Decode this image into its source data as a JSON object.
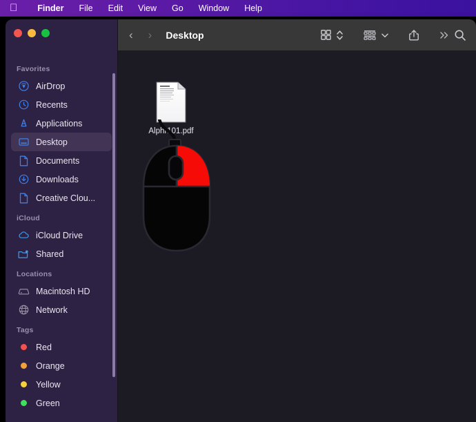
{
  "menubar": {
    "apple_icon": "apple-logo",
    "items": [
      {
        "label": "Finder",
        "bold": true
      },
      {
        "label": "File",
        "bold": false
      },
      {
        "label": "Edit",
        "bold": false
      },
      {
        "label": "View",
        "bold": false
      },
      {
        "label": "Go",
        "bold": false
      },
      {
        "label": "Window",
        "bold": false
      },
      {
        "label": "Help",
        "bold": false
      }
    ]
  },
  "window": {
    "traffic_lights": {
      "close_color": "#f2564f",
      "minimize_color": "#fcbb40",
      "maximize_color": "#17c341"
    },
    "toolbar": {
      "back_icon": "chevron-left-icon",
      "forward_icon": "chevron-right-icon",
      "title": "Desktop",
      "view_icon": "icon-view-grid-icon",
      "view_stepper_icon": "chevron-up-down-icon",
      "group_icon": "group-by-icon",
      "group_chevron_icon": "chevron-down-icon",
      "share_icon": "share-icon",
      "more_icon": "double-chevron-right-icon",
      "search_icon": "search-icon"
    }
  },
  "sidebar": {
    "sections": [
      {
        "title": "Favorites",
        "items": [
          {
            "label": "AirDrop",
            "icon": "airdrop-icon",
            "selected": false
          },
          {
            "label": "Recents",
            "icon": "clock-icon",
            "selected": false
          },
          {
            "label": "Applications",
            "icon": "applications-icon",
            "selected": false
          },
          {
            "label": "Desktop",
            "icon": "desktop-icon",
            "selected": true
          },
          {
            "label": "Documents",
            "icon": "document-icon",
            "selected": false
          },
          {
            "label": "Downloads",
            "icon": "download-icon",
            "selected": false
          },
          {
            "label": "Creative Clou...",
            "icon": "document-icon",
            "selected": false
          }
        ]
      },
      {
        "title": "iCloud",
        "items": [
          {
            "label": "iCloud Drive",
            "icon": "cloud-icon",
            "selected": false
          },
          {
            "label": "Shared",
            "icon": "shared-folder-icon",
            "selected": false
          }
        ]
      },
      {
        "title": "Locations",
        "items": [
          {
            "label": "Macintosh HD",
            "icon": "hard-drive-icon",
            "selected": false
          },
          {
            "label": "Network",
            "icon": "globe-icon",
            "selected": false
          }
        ]
      },
      {
        "title": "Tags",
        "items": [
          {
            "label": "Red",
            "icon": "tag-dot-icon",
            "color": "#f4514f",
            "selected": false
          },
          {
            "label": "Orange",
            "icon": "tag-dot-icon",
            "color": "#f1a03a",
            "selected": false
          },
          {
            "label": "Yellow",
            "icon": "tag-dot-icon",
            "color": "#f7d13c",
            "selected": false
          },
          {
            "label": "Green",
            "icon": "tag-dot-icon",
            "color": "#3ee05e",
            "selected": false
          }
        ]
      }
    ]
  },
  "content": {
    "files": [
      {
        "name": "Alphr101.pdf",
        "icon": "pdf-file-icon"
      }
    ],
    "illustration": {
      "name": "computer-mouse-right-click-highlight",
      "body_color": "#050505",
      "highlight_color": "#f60b06",
      "outline_color": "#2a2830"
    }
  }
}
